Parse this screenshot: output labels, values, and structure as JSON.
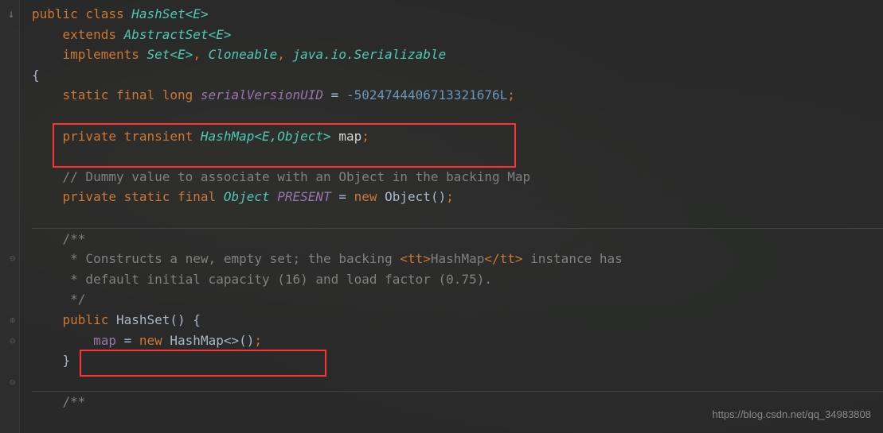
{
  "code": {
    "l1_public": "public",
    "l1_class": " class ",
    "l1_type": "HashSet",
    "l1_gen": "<E>",
    "l2_ext": "extends ",
    "l2_type": "AbstractSet",
    "l2_gen": "<E>",
    "l3_impl": "implements ",
    "l3_set": "Set",
    "l3_gen": "<E>",
    "l3_rest1": ", ",
    "l3_clone": "Cloneable",
    "l3_rest2": ", ",
    "l3_serial": "java.io.Serializable",
    "l4": "{",
    "l5_kw": "static final long ",
    "l5_field": "serialVersionUID",
    "l5_eq": " = ",
    "l5_num": "-5024744406713321676L",
    "l5_semi": ";",
    "l7_kw": "private transient ",
    "l7_type": "HashMap",
    "l7_gen": "<E,Object>",
    "l7_map": " map",
    "l7_semi": ";",
    "l9_comment": "// Dummy value to associate with an Object in the backing Map",
    "l10_kw": "private static final ",
    "l10_type": "Object",
    "l10_sp": " ",
    "l10_field": "PRESENT",
    "l10_eq": " = ",
    "l10_new": "new ",
    "l10_obj": "Object",
    "l10_paren": "()",
    "l10_semi": ";",
    "l12_c1": "/**",
    "l13_c1": " * Constructs a new, empty set; the backing ",
    "l13_tag1": "<tt>",
    "l13_hm": "HashMap",
    "l13_tag2": "</tt>",
    "l13_c2": " instance has",
    "l14_c": " * default initial capacity (16) and load factor (0.75).",
    "l15_c": " */",
    "l16_pub": "public ",
    "l16_hs": "HashSet",
    "l16_paren": "() {",
    "l17_map": "map",
    "l17_eq": " = ",
    "l17_new": "new ",
    "l17_hm": "HashMap",
    "l17_gen": "<>",
    "l17_paren": "()",
    "l17_semi": ";",
    "l18": "}",
    "l20_c": "/**"
  },
  "watermark": "https://blog.csdn.net/qq_34983808"
}
